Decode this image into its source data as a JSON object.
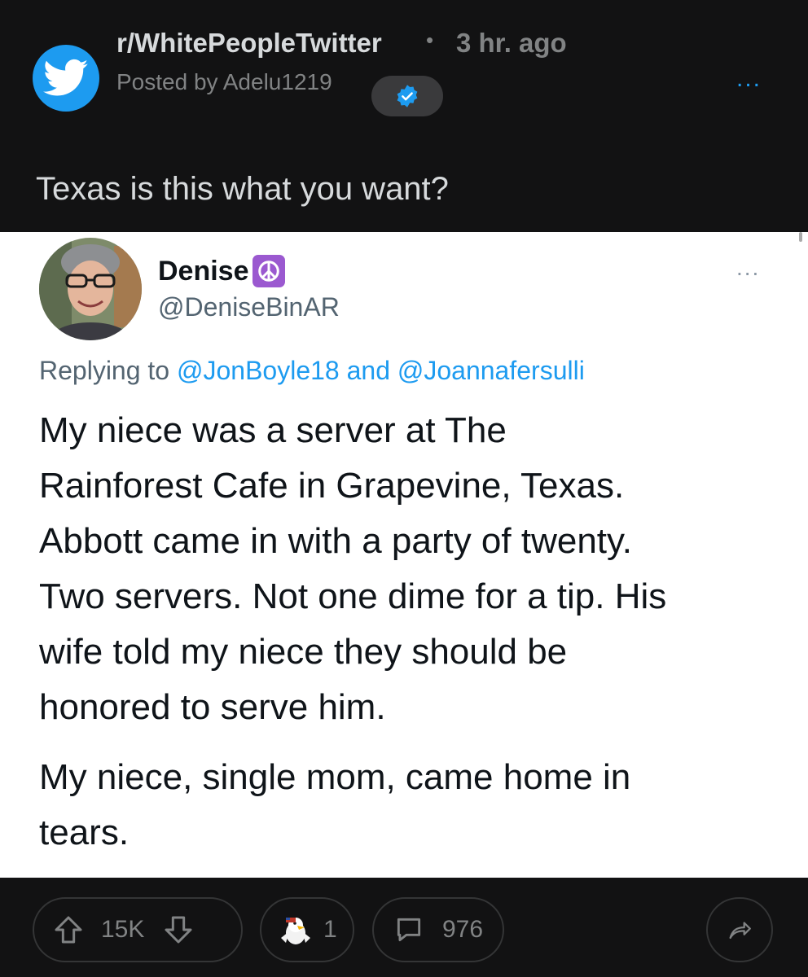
{
  "post": {
    "subreddit": "r/WhitePeopleTwitter",
    "separator": "•",
    "time_ago": "3 hr. ago",
    "posted_by": "Posted by Adelu1219",
    "more_icon": "ellipsis-icon",
    "more_glyph": "...",
    "title": "Texas is this what you want?",
    "accent_color": "#1d9bf0"
  },
  "tweet": {
    "display_name": "Denise",
    "handle": "@DeniseBinAR",
    "more_glyph": "...",
    "replying_prefix": "Replying to",
    "mention_1": "@JonBoyle18",
    "conjunction": "and",
    "mention_2": "@Joannafersulli",
    "body_p1": "My niece was a server at The\nRainforest Cafe in Grapevine, Texas.\nAbbott came in with a party of twenty.\nTwo servers. Not one dime for a tip. His\nwife told my niece they should be\nhonored to serve him.",
    "body_p2": "My niece, single mom, came home in\ntears."
  },
  "actions": {
    "upvote_icon": "upvote-arrow-icon",
    "vote_count": "15K",
    "downvote_icon": "downvote-arrow-icon",
    "award_icon": "eagle-award-icon",
    "award_count": "1",
    "comment_icon": "comment-bubble-icon",
    "comment_count": "976",
    "share_icon": "share-arrow-icon"
  }
}
